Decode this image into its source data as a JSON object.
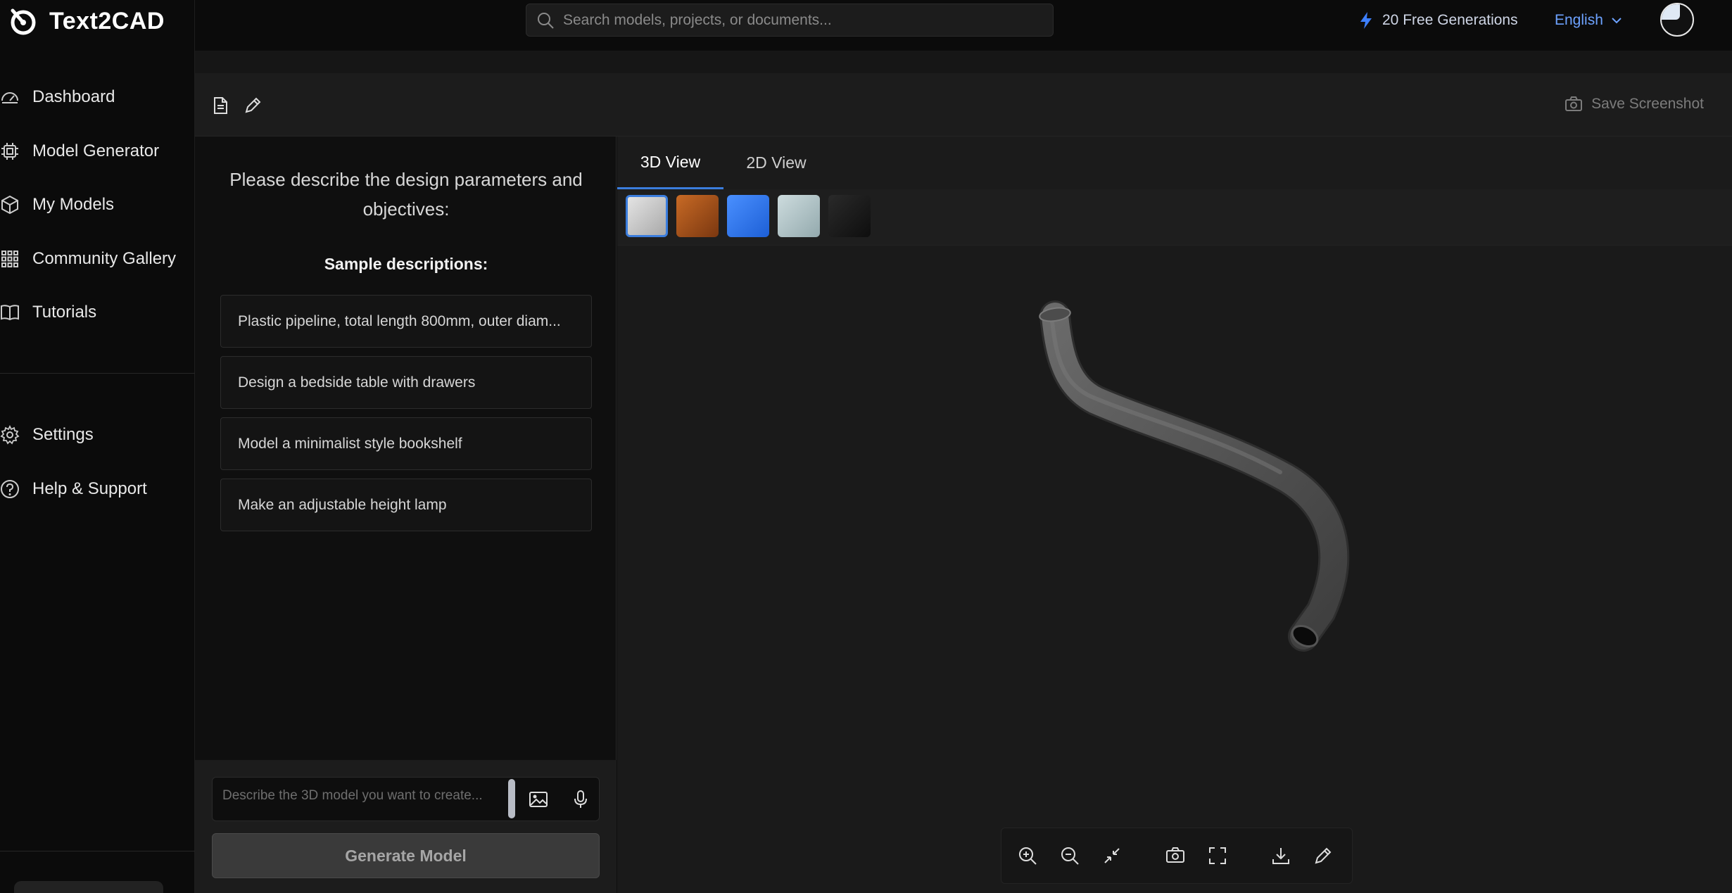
{
  "app": {
    "name": "Text2CAD"
  },
  "sidebar": {
    "items": [
      {
        "label": "Dashboard",
        "icon": "dashboard-icon"
      },
      {
        "label": "Model Generator",
        "icon": "chip-icon"
      },
      {
        "label": "My Models",
        "icon": "cube-icon"
      },
      {
        "label": "Community Gallery",
        "icon": "grid-icon"
      },
      {
        "label": "Tutorials",
        "icon": "book-icon"
      }
    ],
    "secondary": [
      {
        "label": "Settings",
        "icon": "gear-icon"
      },
      {
        "label": "Help & Support",
        "icon": "help-icon"
      }
    ]
  },
  "topbar": {
    "search_placeholder": "Search models, projects, or documents...",
    "credits": "20 Free Generations",
    "language": "English"
  },
  "toolbar": {
    "save_screenshot": "Save Screenshot"
  },
  "prompt": {
    "title": "Please describe the design parameters and objectives:",
    "sample_title": "Sample descriptions:",
    "samples": [
      "Plastic pipeline, total length 800mm, outer diam...",
      "Design a bedside table with drawers",
      "Model a minimalist style bookshelf",
      "Make an adjustable height lamp"
    ],
    "input_placeholder": "Describe the 3D model you want to create...",
    "generate_label": "Generate Model"
  },
  "viewer": {
    "tabs": [
      "3D View",
      "2D View"
    ],
    "active_tab": "3D View",
    "material_swatches": [
      {
        "name": "silver",
        "color": "#c9c9c9",
        "selected": true
      },
      {
        "name": "copper",
        "color": "#b35a1f",
        "selected": false
      },
      {
        "name": "blue",
        "color": "#2f7bf5",
        "selected": false
      },
      {
        "name": "glass",
        "color": "#b5c7ca",
        "selected": false
      },
      {
        "name": "black",
        "color": "#1c1c1c",
        "selected": false
      }
    ],
    "model_color": "#555555",
    "controls": [
      "zoom-in-icon",
      "zoom-out-icon",
      "reset-view-icon",
      "camera-icon",
      "fullscreen-icon",
      "download-icon",
      "edit-icon"
    ]
  },
  "colors": {
    "accent": "#3b7ddd",
    "link": "#6da2ff",
    "background": "#0f0f0f"
  }
}
